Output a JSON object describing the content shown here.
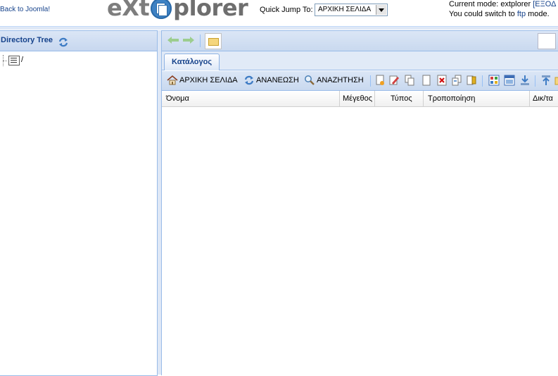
{
  "header": {
    "back_link": "Back to Joomla!",
    "logo_left": "eXt",
    "logo_right": "plorer",
    "quick_jump_label": "Quick Jump To:",
    "quick_jump_value": "ΑΡΧΙΚΗ ΣΕΛΙΔΑ",
    "mode_prefix": "Current mode: extplorer",
    "mode_logout": "[ΕΞΟΔ",
    "switch_prefix": "You could switch to",
    "switch_link": "ftp",
    "switch_suffix": "mode."
  },
  "west": {
    "title": "Directory Tree",
    "tree_root": "/"
  },
  "tabs": [
    {
      "label": "Κατάλογος"
    }
  ],
  "toolbar": {
    "home_label": "ΑΡΧΙΚΗ ΣΕΛΙΔΑ",
    "refresh_label": "ΑΝΑΝΕΩΣΗ",
    "search_label": "ΑΝΑΖΗΤΗΣΗ"
  },
  "grid": {
    "columns": [
      "Όνομα",
      "Μέγεθος",
      "Τύπος",
      "Τροποποίηση",
      "Δικ/τα"
    ],
    "rows": []
  },
  "colors": {
    "accent": "#15428b",
    "panel_border": "#99bbe8",
    "header_bg": "#dfe8f6"
  }
}
